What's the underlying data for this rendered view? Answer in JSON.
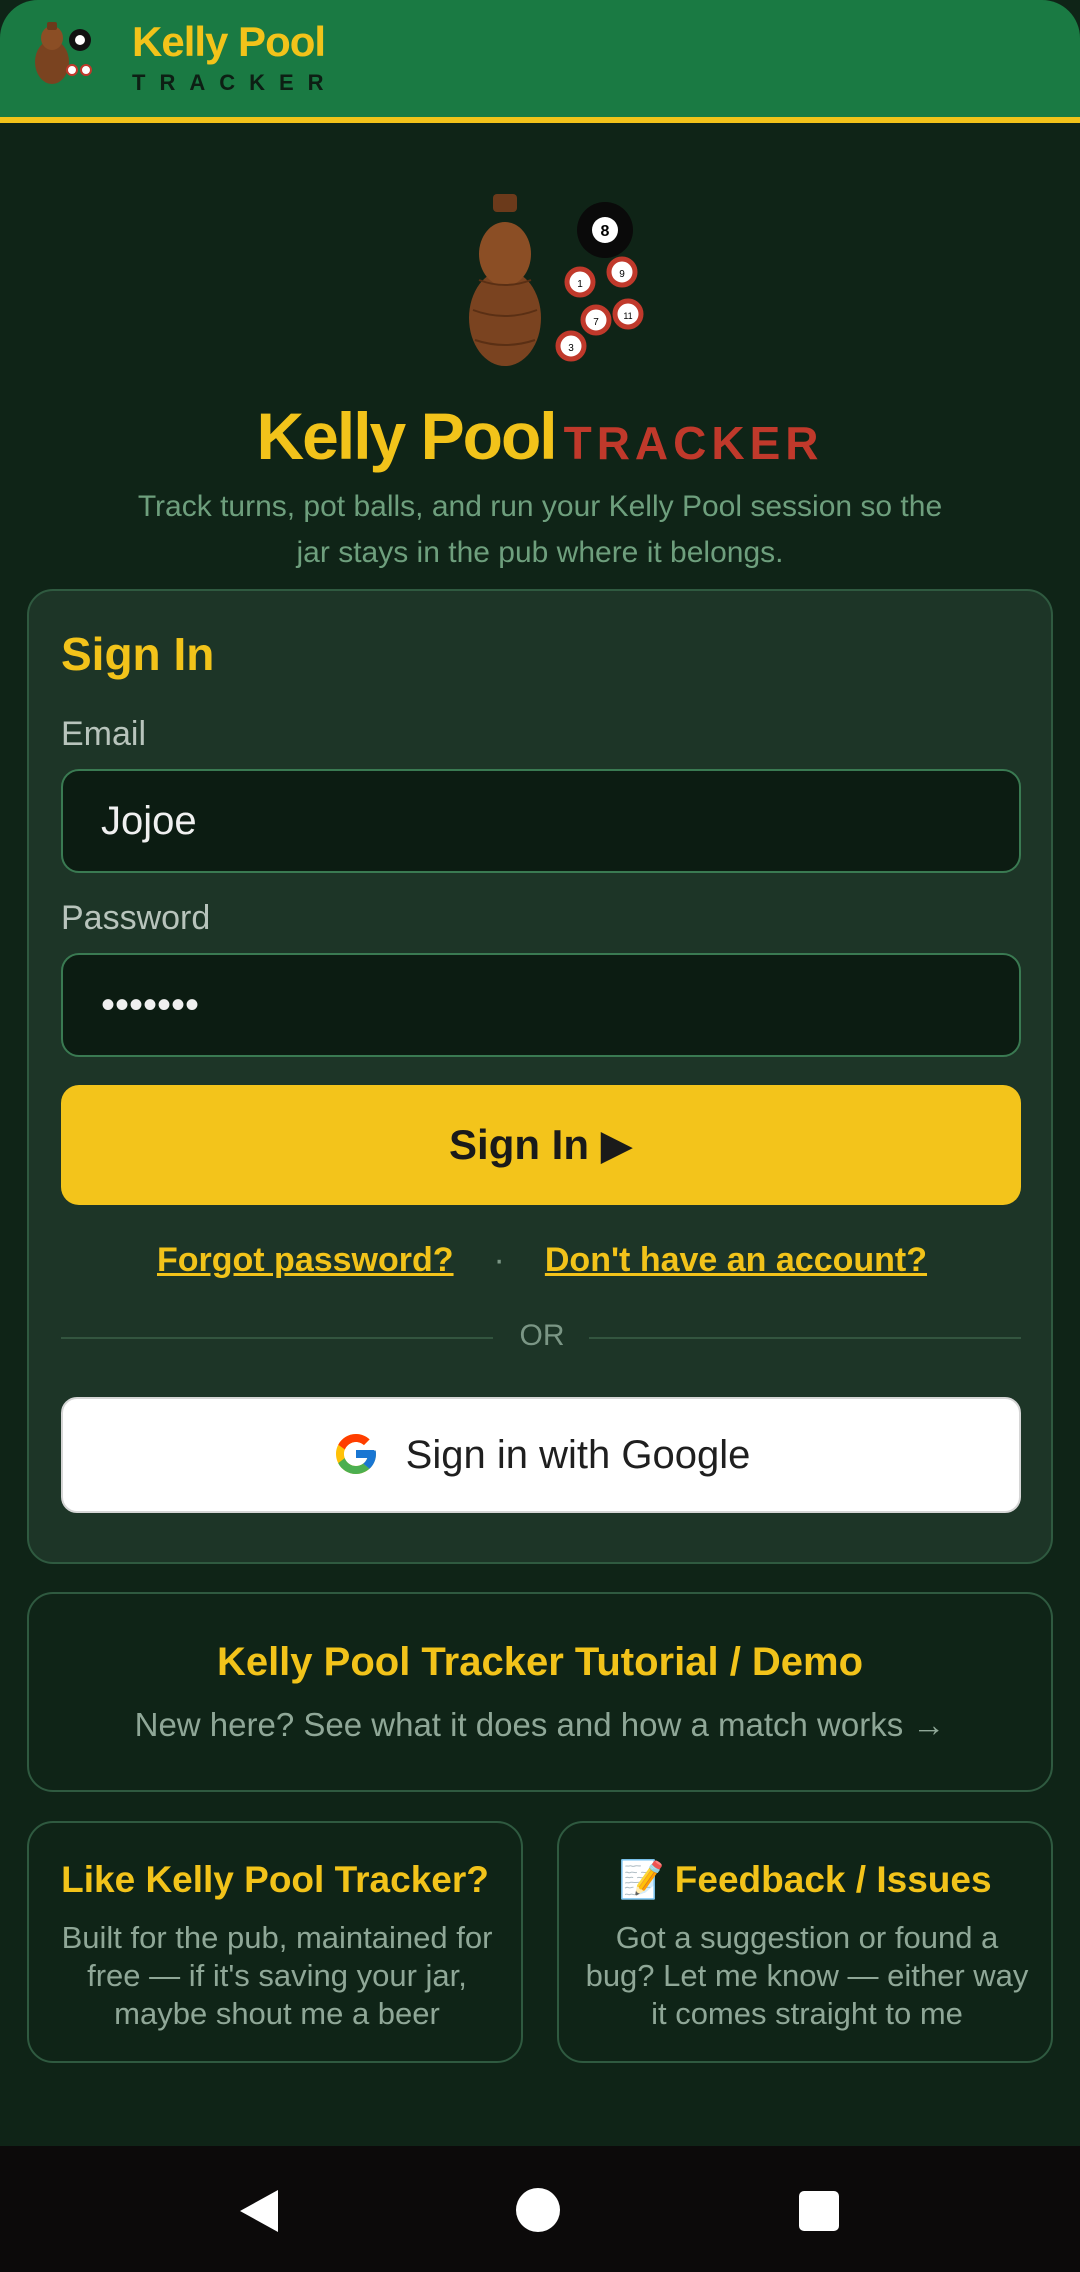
{
  "header": {
    "brand": "Kelly Pool",
    "brand_sub": "TRACKER"
  },
  "hero": {
    "title": "Kelly Pool",
    "title_suffix": "TRACKER",
    "tagline": "Track turns, pot balls, and run your Kelly Pool session so the jar stays in the pub where it belongs.",
    "balls": [
      "8",
      "1",
      "9",
      "7",
      "11",
      "3"
    ]
  },
  "signin": {
    "title": "Sign In",
    "email_label": "Email",
    "email_value": "Jojoe",
    "password_label": "Password",
    "password_value": "•••••••",
    "submit_label": "Sign In ▶",
    "forgot_link": "Forgot password?",
    "separator": "·",
    "register_link": "Don't have an account?",
    "or_label": "OR",
    "google_label": "Sign in with Google"
  },
  "tutorial": {
    "title": "Kelly Pool Tracker Tutorial / Demo",
    "subtitle": "New here? See what it does and how a match works →"
  },
  "support": {
    "title": "Like Kelly Pool Tracker?",
    "body": "Built for the pub, maintained for free — if it's saving your jar, maybe shout me a beer"
  },
  "feedback": {
    "title": "📝 Feedback / Issues",
    "body": "Got a suggestion or found a bug? Let me know — either way it comes straight to me"
  },
  "colors": {
    "accent": "#f2c31a",
    "header_bg": "#1a7a43",
    "page_bg": "#0f2417",
    "card_bg": "#1d3527",
    "tracker_red": "#c0392b"
  },
  "icons": {
    "logo": "kelly-jar-logo-icon",
    "google": "google-g-icon",
    "nav": [
      "back-triangle-icon",
      "home-circle-icon",
      "recents-square-icon"
    ]
  }
}
